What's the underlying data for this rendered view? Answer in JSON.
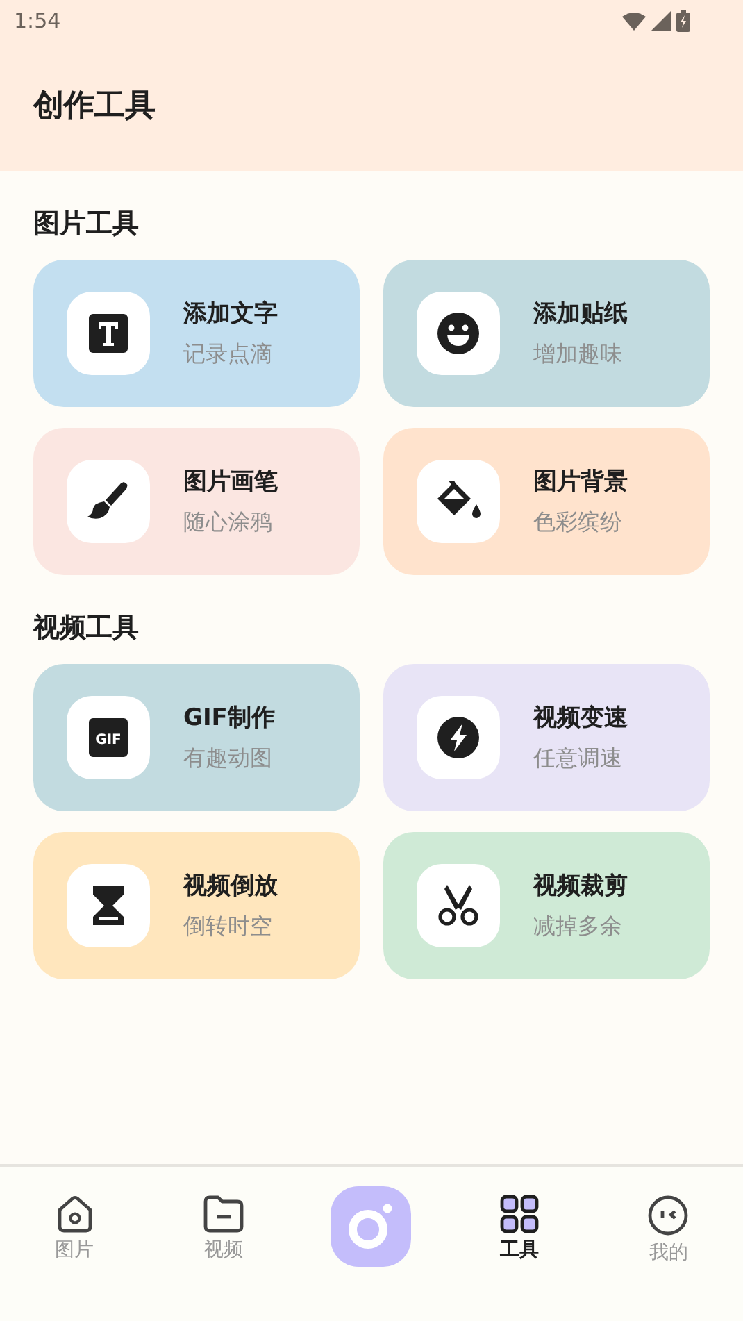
{
  "status_bar": {
    "time": "1:54"
  },
  "header": {
    "title": "创作工具"
  },
  "sections": [
    {
      "title": "图片工具",
      "tools": [
        {
          "kind": "text",
          "title": "添加文字",
          "subtitle": "记录点滴",
          "color": "#c3dff0"
        },
        {
          "kind": "sticker",
          "title": "添加贴纸",
          "subtitle": "增加趣味",
          "color": "#c2dbe0"
        },
        {
          "kind": "brush",
          "title": "图片画笔",
          "subtitle": "随心涂鸦",
          "color": "#fbe6e1"
        },
        {
          "kind": "fill",
          "title": "图片背景",
          "subtitle": "色彩缤纷",
          "color": "#ffe3cd"
        }
      ]
    },
    {
      "title": "视频工具",
      "tools": [
        {
          "kind": "gif",
          "icon_text": "GIF",
          "title": "GIF制作",
          "subtitle": "有趣动图",
          "color": "#c2dbe0"
        },
        {
          "kind": "speed",
          "title": "视频变速",
          "subtitle": "任意调速",
          "color": "#e8e4f6"
        },
        {
          "kind": "reverse",
          "title": "视频倒放",
          "subtitle": "倒转时空",
          "color": "#ffe6bd"
        },
        {
          "kind": "cut",
          "title": "视频裁剪",
          "subtitle": "减掉多余",
          "color": "#cfead6"
        }
      ]
    }
  ],
  "nav": [
    {
      "kind": "home",
      "label": "图片",
      "selected": false
    },
    {
      "kind": "folder",
      "label": "视频",
      "selected": false
    },
    {
      "kind": "camera"
    },
    {
      "kind": "grid",
      "label": "工具",
      "selected": true
    },
    {
      "kind": "face",
      "label": "我的",
      "selected": false
    }
  ]
}
